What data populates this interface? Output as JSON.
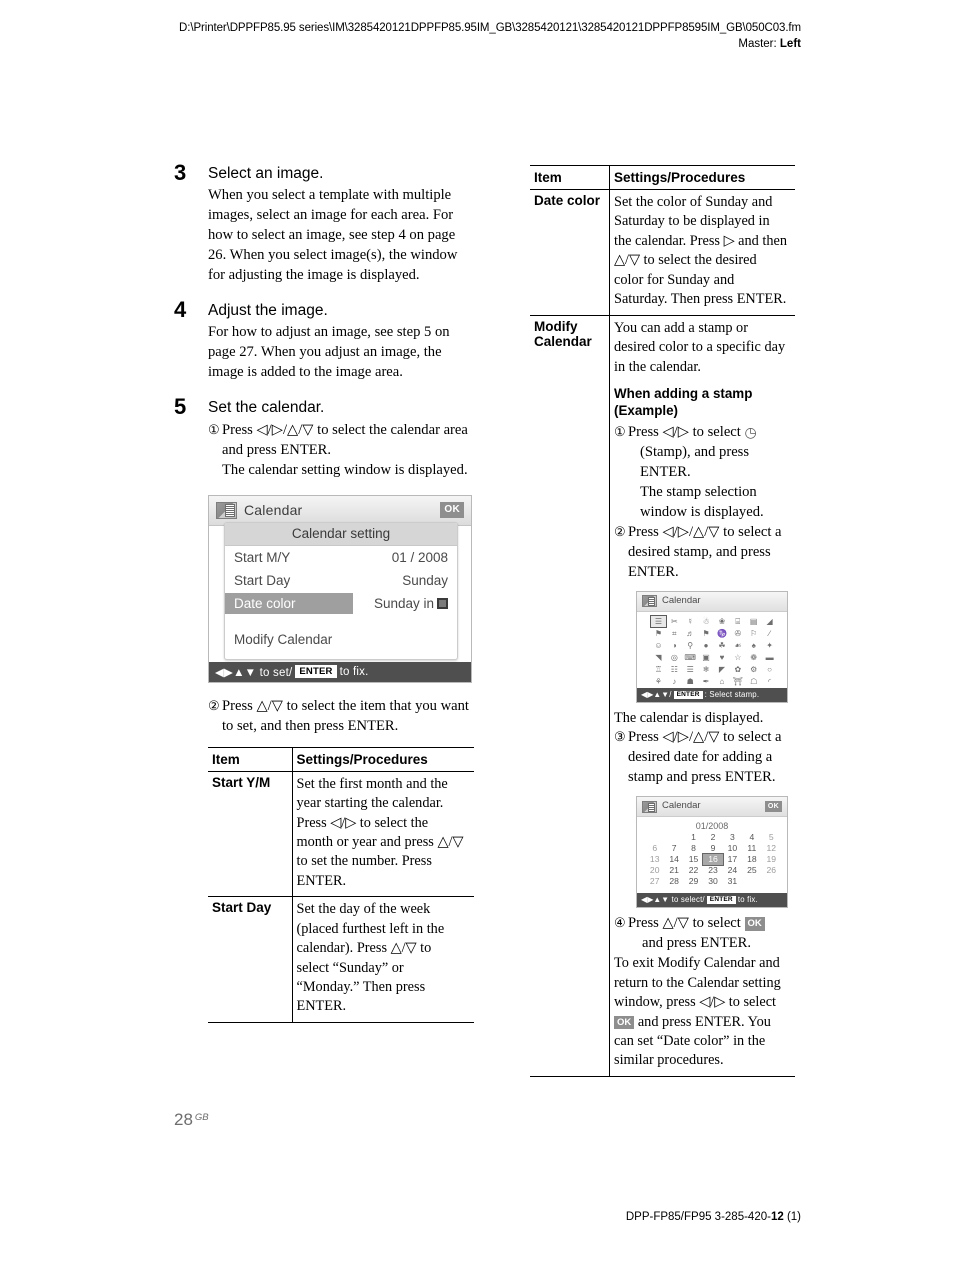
{
  "header": {
    "file_path": "D:\\Printer\\DPPFP85.95 series\\IM\\3285420121DPPFP85.95IM_GB\\3285420121\\3285420121DPPFP8595IM_GB\\050C03.fm",
    "master_label": "Master: ",
    "master_value": "Left"
  },
  "footer": {
    "page_number": "28",
    "page_suffix": "GB",
    "model_text": "DPP-FP85/FP95 3-285-420-",
    "model_bold": "12",
    "model_tail": " (1)"
  },
  "left_column": {
    "steps": [
      {
        "number": "3",
        "title": "Select an image.",
        "text": "When you select a template with multiple images, select an image for each area. For how to select an image, see step 4 on page 26. When you select image(s), the window for adjusting the image is displayed."
      },
      {
        "number": "4",
        "title": "Adjust the image.",
        "text": "For how to adjust an image, see step 5 on page 27. When you adjust an image, the image is added to the image area."
      },
      {
        "number": "5",
        "title": "Set the calendar.",
        "sub_marker": "①",
        "sub_text": "Press ◁/▷/△/▽ to select the calendar area and press ENTER.",
        "sub_cont": "The calendar setting window is displayed."
      }
    ],
    "calendar_setting_lcd": {
      "icon_name": "calendar-icon",
      "title": "Calendar",
      "ok_badge": "OK",
      "panel_title": "Calendar setting",
      "rows": [
        {
          "label": "Start M/Y",
          "value": "01 /  2008",
          "selected": false,
          "swatch": false
        },
        {
          "label": "Start Day",
          "value": "Sunday",
          "selected": false,
          "swatch": false
        },
        {
          "label": "Date color",
          "value": "Sunday in",
          "selected": true,
          "swatch": true
        },
        {
          "label": "Modify Calendar",
          "value": "",
          "selected": false,
          "swatch": false
        }
      ],
      "status_prefix": "◀▶▲▼ to set/",
      "status_key": "ENTER",
      "status_suffix": " to fix."
    },
    "after_lcd": {
      "marker": "②",
      "text": "Press △/▽ to select the item that you want to set, and then press ENTER."
    },
    "table": {
      "headers": [
        "Item",
        "Settings/Procedures"
      ],
      "rows": [
        {
          "item": "Start Y/M",
          "procedure": "Set the first month and the year starting the calendar. Press ◁/▷ to select the month or year and press △/▽ to set the number. Press ENTER."
        },
        {
          "item": "Start Day",
          "procedure": "Set the day of the week (placed furthest left in the calendar). Press △/▽ to select “Sunday” or “Monday.” Then press ENTER."
        }
      ]
    }
  },
  "right_column": {
    "table": {
      "headers": [
        "Item",
        "Settings/Procedures"
      ],
      "rows": [
        {
          "item": "Date color",
          "procedure": "Set the color of Sunday and Saturday to be displayed in the calendar. Press ▷ and then △/▽ to select the desired color for Sunday and Saturday. Then press ENTER."
        },
        {
          "item": "Modify Calendar",
          "intro": "You can add a stamp or desired color to a specific day in the calendar.",
          "heading": "When adding a stamp (Example)",
          "step1_marker": "①",
          "step1_a": "Press ◁/▷ to select",
          "step1_b": "(Stamp), and press ENTER.",
          "step1_c": "The stamp selection window is displayed.",
          "step2_marker": "②",
          "step2_text": "Press ◁/▷/△/▽ to select a desired stamp, and press ENTER.",
          "after_stamp_lcd": "The calendar is displayed.",
          "step3_marker": "③",
          "step3_text": "Press ◁/▷/△/▽ to select a desired date for adding a stamp and press ENTER.",
          "step4_marker": "④",
          "step4_a": "Press △/▽ to select",
          "step4_ok": "OK",
          "step4_b": "and press ENTER.",
          "closing_a": "To exit Modify Calendar and return to the Calendar setting window, press ◁/▷ to select",
          "closing_ok": "OK",
          "closing_b": "and press ENTER. You can set “Date color” in the similar procedures."
        }
      ]
    },
    "stamp_lcd": {
      "icon_name": "calendar-icon",
      "title": "Calendar",
      "status_prefix": "◀▶▲▼/",
      "status_key": "ENTER",
      "status_suffix": ": Select stamp.",
      "grid_columns": 8,
      "grid_rows": 7,
      "selected_index": 0,
      "glyphs": [
        "☰",
        "✂",
        "☿",
        "☃",
        "❀",
        "⌸",
        "▤",
        "◢",
        "⚑",
        "⌗",
        "♬",
        "⚑",
        "♑",
        "✇",
        "⚐",
        "∕",
        "☺",
        "◑",
        "⚲",
        "●",
        "☘",
        "☙",
        "♠",
        "✦",
        "◥",
        "◎",
        "⌨",
        "▣",
        "♥",
        "☆",
        "❁",
        "▬",
        "♖",
        "☷",
        "☰",
        "❄",
        "◤",
        "✿",
        "⚙",
        "○",
        "⚘",
        "♪",
        "☗",
        "✒",
        "⌂",
        "⛩",
        "☖",
        "◜",
        "⁂",
        "⁕",
        "⁑",
        "⁃",
        "‣",
        "․",
        "‥",
        "…"
      ]
    },
    "date_lcd": {
      "icon_name": "calendar-icon",
      "title": "Calendar",
      "ok_badge": "OK",
      "month_label": "01/2008",
      "weeks": [
        [
          "",
          "",
          "1",
          "2",
          "3",
          "4",
          "5"
        ],
        [
          "6",
          "7",
          "8",
          "9",
          "10",
          "11",
          "12"
        ],
        [
          "13",
          "14",
          "15",
          "16",
          "17",
          "18",
          "19"
        ],
        [
          "20",
          "21",
          "22",
          "23",
          "24",
          "25",
          "26"
        ],
        [
          "27",
          "28",
          "29",
          "30",
          "31",
          "",
          ""
        ]
      ],
      "selected_cell": "16",
      "status_prefix": "◀▶▲▼ to select/",
      "status_key": "ENTER",
      "status_suffix": " to fix."
    }
  }
}
